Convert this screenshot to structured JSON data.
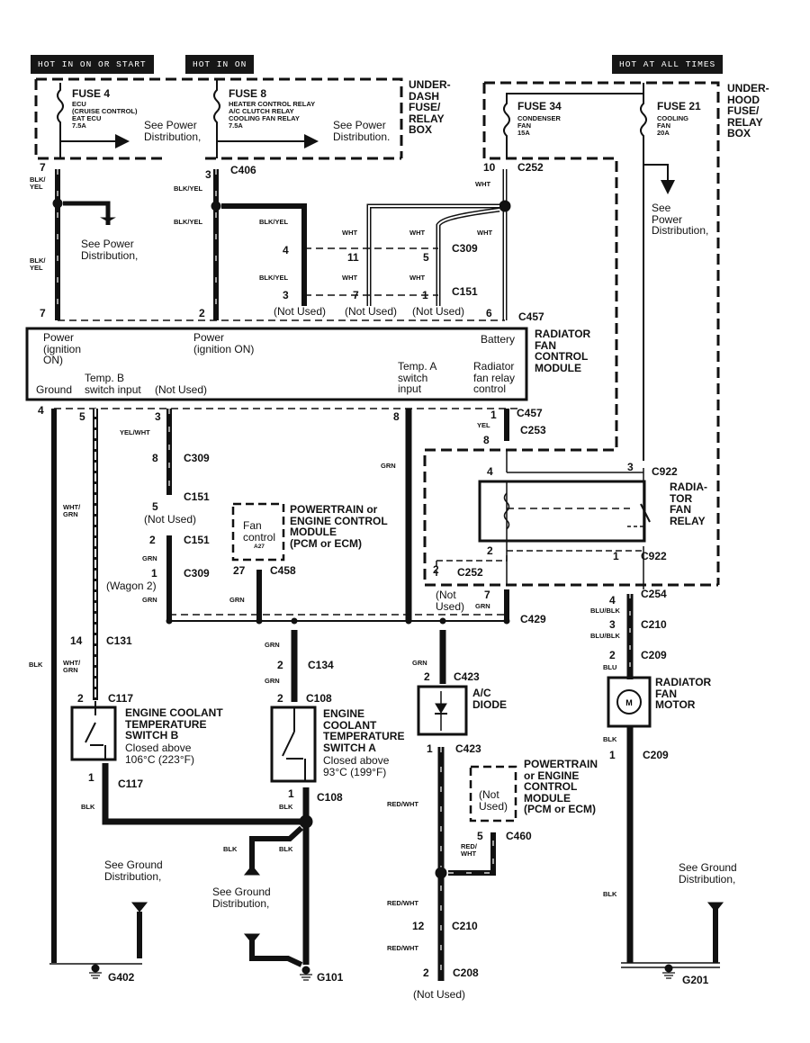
{
  "hot_labels": {
    "on_or_start": "HOT IN ON OR START",
    "on": "HOT IN ON",
    "all_times": "HOT AT ALL TIMES"
  },
  "boxes": {
    "underdash": "UNDER-\nDASH\nFUSE/\nRELAY\nBOX",
    "underhood": "UNDER-\nHOOD\nFUSE/\nRELAY\nBOX"
  },
  "fuses": {
    "fuse4": {
      "title": "FUSE 4",
      "desc": "ECU\n(CRUISE CONTROL)\nEAT ECU\n7.5A"
    },
    "fuse8": {
      "title": "FUSE 8",
      "desc": "HEATER CONTROL RELAY\nA/C CLUTCH RELAY\nCOOLING FAN RELAY\n7.5A"
    },
    "fuse34": {
      "title": "FUSE 34",
      "desc": "CONDENSER\nFAN\n15A"
    },
    "fuse21": {
      "title": "FUSE 21",
      "desc": "COOLING\nFAN\n20A"
    }
  },
  "refs": {
    "see_power": "See Power\nDistribution,",
    "see_power_alt": "See Power\nDistribution.",
    "see_power_col": "See\nPower\nDistribution,",
    "see_ground": "See Ground\nDistribution,"
  },
  "module": {
    "name": "RADIATOR\nFAN\nCONTROL\nMODULE",
    "pin_power_ign": "Power\n(ignition\nON)",
    "pin_power_ign2": "Power\n(ignition ON)",
    "pin_battery": "Battery",
    "pin_ground": "Ground",
    "pin_tempb": "Temp. B\nswitch input",
    "pin_not_used": "(Not Used)",
    "pin_tempa": "Temp. A\nswitch\ninput",
    "pin_relay": "Radiator\nfan relay\ncontrol"
  },
  "wires": {
    "blk_yel_split": "BLK/\nYEL",
    "blk_yel": "BLK/YEL",
    "wht": "WHT",
    "yel_wht": "YEL/WHT",
    "grn": "GRN",
    "wht_grn": "WHT/\nGRN",
    "blk": "BLK",
    "yel": "YEL",
    "blu_blk": "BLU/BLK",
    "blu": "BLU",
    "red_wht": "RED/WHT",
    "red_wht_split": "RED/\nWHT"
  },
  "connectors": {
    "c406": "C406",
    "c252": "C252",
    "c309": "C309",
    "c151": "C151",
    "c457": "C457",
    "c253": "C253",
    "c922": "C922",
    "c458": "C458",
    "c429": "C429",
    "c254": "C254",
    "c210": "C210",
    "c209": "C209",
    "c131": "C131",
    "c134": "C134",
    "c117": "C117",
    "c108": "C108",
    "c423": "C423",
    "c460": "C460",
    "c208": "C208"
  },
  "pins": {
    "p1": "1",
    "p2": "2",
    "p3": "3",
    "p4": "4",
    "p5": "5",
    "p6": "6",
    "p7": "7",
    "p8": "8",
    "p10": "10",
    "p11": "11",
    "p12": "12",
    "p14": "14",
    "p27": "27"
  },
  "notes": {
    "not_used": "(Not Used)",
    "not_used_split": "(Not\nUsed)",
    "wagon2": "(Wagon 2)"
  },
  "components": {
    "relay": "RADIA-\nTOR\nFAN\nRELAY",
    "pcm1": "POWERTRAIN or\nENGINE CONTROL\nMODULE\n(PCM or ECM)",
    "pcm1_inner": "Fan\ncontrol",
    "pcm1_pin": "A27",
    "pcm2": "POWERTRAIN\nor ENGINE\nCONTROL\nMODULE\n(PCM or ECM)",
    "pcm2_inner": "(Not\nUsed)",
    "switch_b": "ENGINE COOLANT\nTEMPERATURE\nSWITCH B",
    "switch_b_note": "Closed above\n106°C (223°F)",
    "switch_a": "ENGINE\nCOOLANT\nTEMPERATURE\nSWITCH A",
    "switch_a_note": "Closed above\n93°C (199°F)",
    "diode": "A/C\nDIODE",
    "motor": "RADIATOR\nFAN\nMOTOR",
    "motor_symbol": "M"
  },
  "grounds": {
    "g402": "G402",
    "g101": "G101",
    "g201": "G201"
  }
}
